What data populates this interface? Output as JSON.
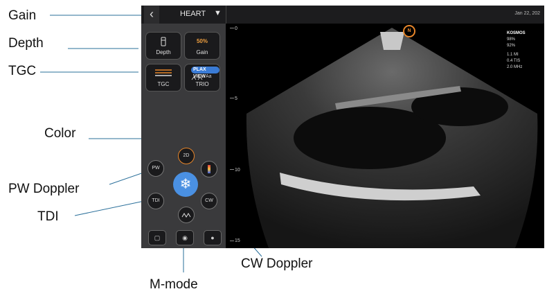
{
  "callouts": {
    "gain": "Gain",
    "depth": "Depth",
    "tgc": "TGC",
    "color": "Color",
    "pw_doppler": "PW Doppler",
    "tdi": "TDI",
    "cw_doppler": "CW Doppler",
    "m_mode": "M-mode"
  },
  "topbar": {
    "preset": "HEART",
    "date": "Jan 22, 202"
  },
  "panel": {
    "depth_label": "Depth",
    "gain_value": "50%",
    "gain_label": "Gain",
    "tgc_label": "TGC",
    "plax_badge": "PLAX VIEW",
    "trio_aa": "Aa",
    "trio_label": "TRIO",
    "mode_2d": "2D",
    "mode_pw": "PW",
    "mode_tdi": "TDI",
    "mode_cw": "CW"
  },
  "ruler": [
    "0",
    "5",
    "10",
    "15"
  ],
  "info": {
    "brand": "KOSMOS",
    "battery_probe": "98%",
    "battery_device": "92%",
    "mi": "1.1   MI",
    "tis": "0.4   TIS",
    "mhz": "2.0   MHz"
  },
  "marker": "N",
  "colors": {
    "accent_orange": "#e8862a",
    "freeze_blue": "#4a90e2",
    "plax_blue": "#3a7bd5",
    "leader_blue": "#2a6f9a"
  },
  "icons": [
    "back-chevron-icon",
    "caret-down-icon",
    "depth-icon",
    "tgc-icon",
    "snowflake-icon",
    "color-bar-icon",
    "mmode-icon",
    "gallery-icon",
    "camera-icon",
    "record-icon",
    "orientation-marker-icon"
  ]
}
